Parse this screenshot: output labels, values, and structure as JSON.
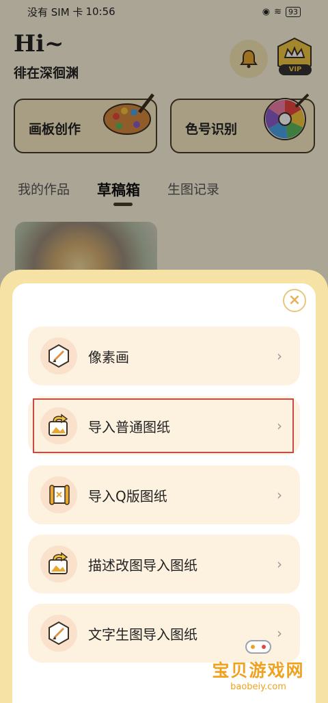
{
  "status_bar": {
    "carrier": "没有 SIM 卡",
    "time": "10:56",
    "battery": "93"
  },
  "header": {
    "greeting": "Hi~",
    "username": "徘在深徊渊",
    "vip_label": "VIP"
  },
  "cards": [
    {
      "label": "画板创作",
      "icon": "palette-icon"
    },
    {
      "label": "色号识别",
      "icon": "color-wheel-icon"
    }
  ],
  "tabs": [
    {
      "label": "我的作品",
      "active": false
    },
    {
      "label": "草稿箱",
      "active": true
    },
    {
      "label": "生图记录",
      "active": false
    }
  ],
  "sheet": {
    "options": [
      {
        "label": "像素画",
        "icon": "brush-icon"
      },
      {
        "label": "导入普通图纸",
        "icon": "image-import-icon"
      },
      {
        "label": "导入Q版图纸",
        "icon": "scroll-icon"
      },
      {
        "label": "描述改图导入图纸",
        "icon": "image-import-icon"
      },
      {
        "label": "文字生图导入图纸",
        "icon": "brush-icon"
      }
    ],
    "chevron": "›",
    "close": "×"
  },
  "watermark": {
    "title": "宝贝游戏网",
    "url": "baobeiy.com"
  },
  "colors": {
    "sheet_bg": "#f7e2a6",
    "option_bg": "#fdf1df",
    "icon_bg": "#f9e1cc",
    "highlight": "#c94a44",
    "accent": "#e3b25c"
  }
}
